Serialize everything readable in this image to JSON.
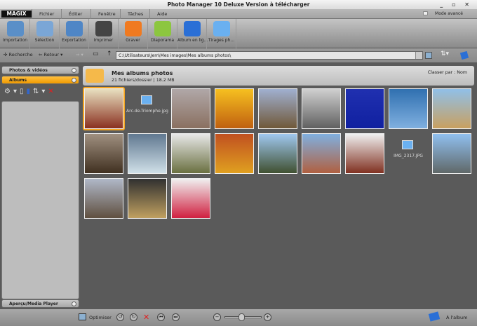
{
  "window": {
    "title": "Photo Manager 10 Deluxe Version à télécharger",
    "controls": "_ ▫ ✕"
  },
  "menu": {
    "logo": "MAGIX",
    "items": [
      "Fichier",
      "Éditer",
      "Fenêtre",
      "Tâches",
      "Aide"
    ],
    "mode": "Mode avancé"
  },
  "toolbar": [
    {
      "label": "Importation",
      "color": "#5a8fc8"
    },
    {
      "label": "Sélection",
      "color": "#7aa6d6"
    },
    {
      "label": "Exportation",
      "color": "#4f86c6"
    },
    {
      "label": "Imprimer",
      "color": "#444444"
    },
    {
      "label": "Graver",
      "color": "#f07a20"
    },
    {
      "label": "Diaporama",
      "color": "#8cc63f"
    },
    {
      "label": "Album en lig...",
      "color": "#2a6fd6"
    },
    {
      "label": "Tirages ph...",
      "color": "#6ab0f0"
    }
  ],
  "nav": {
    "search": "Recherche",
    "back": "Retour",
    "path": "C:\\Utilisateurs\\Jem\\Mes images\\Mes albums photos\\"
  },
  "sidebar": {
    "photos": "Photos & vidéos",
    "albums": "Albums",
    "preview": "Aperçu/Media Player"
  },
  "header": {
    "title": "Mes albums photos",
    "subtitle": "21 fichiers/dossier | 18.2 MB",
    "sort": "Classer par : Nom"
  },
  "files": [
    {
      "name": "",
      "colors": [
        "#e8e0c0",
        "#8a3020"
      ],
      "selected": true
    },
    {
      "name": "Arc-de-Triomphe.jpg",
      "icon": true
    },
    {
      "name": "",
      "colors": [
        "#b0a8a8",
        "#8a7060"
      ]
    },
    {
      "name": "",
      "colors": [
        "#f6c020",
        "#c06010"
      ]
    },
    {
      "name": "",
      "colors": [
        "#a0b0d0",
        "#705838"
      ]
    },
    {
      "name": "",
      "colors": [
        "#d0d0d0",
        "#606060"
      ]
    },
    {
      "name": "",
      "colors": [
        "#2030b0",
        "#1020a0"
      ]
    },
    {
      "name": "",
      "colors": [
        "#3070b0",
        "#80b0e0"
      ]
    },
    {
      "name": "",
      "colors": [
        "#90c0e8",
        "#c8a060"
      ]
    },
    {
      "name": "",
      "colors": [
        "#a09080",
        "#403020"
      ]
    },
    {
      "name": "",
      "colors": [
        "#607890",
        "#d0e0e8"
      ]
    },
    {
      "name": "",
      "colors": [
        "#e8e8e8",
        "#6a7040"
      ]
    },
    {
      "name": "",
      "colors": [
        "#c05020",
        "#e0a020"
      ]
    },
    {
      "name": "",
      "colors": [
        "#a0c8f0",
        "#405030"
      ]
    },
    {
      "name": "",
      "colors": [
        "#80b0e0",
        "#b06040"
      ]
    },
    {
      "name": "",
      "colors": [
        "#f0f0f0",
        "#803020"
      ]
    },
    {
      "name": "IMG_2317.JPG",
      "icon": true
    },
    {
      "name": "",
      "colors": [
        "#90c0f0",
        "#606868"
      ]
    },
    {
      "name": "",
      "colors": [
        "#b0b8c8",
        "#605040"
      ]
    },
    {
      "name": "",
      "colors": [
        "#303030",
        "#c0a060"
      ]
    },
    {
      "name": "",
      "colors": [
        "#f0f0f0",
        "#d02040"
      ]
    }
  ],
  "bottom": {
    "optimize": "Optimiser",
    "album": "À l'album"
  }
}
